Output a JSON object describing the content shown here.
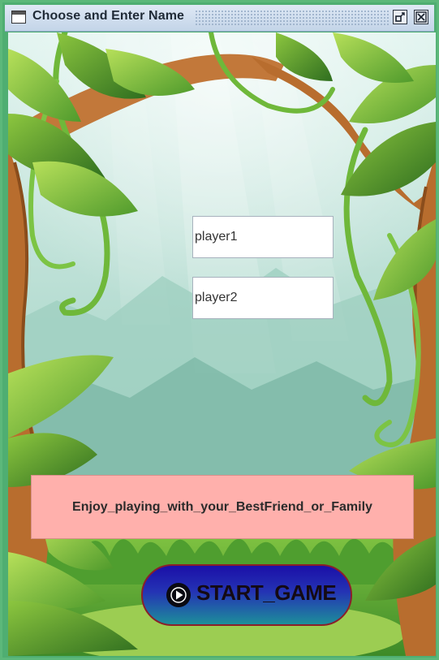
{
  "window": {
    "title": "Choose and Enter Name"
  },
  "form": {
    "player1_value": "player1",
    "player2_value": "player2"
  },
  "banner": {
    "text": "Enjoy_playing_with_your_BestFriend_or_Family"
  },
  "start_button": {
    "label": "START_GAME",
    "icon": "play-circle-icon"
  },
  "colors": {
    "banner_bg": "#ffb0ac",
    "button_top": "#1b0fa8",
    "button_bottom": "#1d8f9a",
    "window_border": "#5cb87a"
  }
}
